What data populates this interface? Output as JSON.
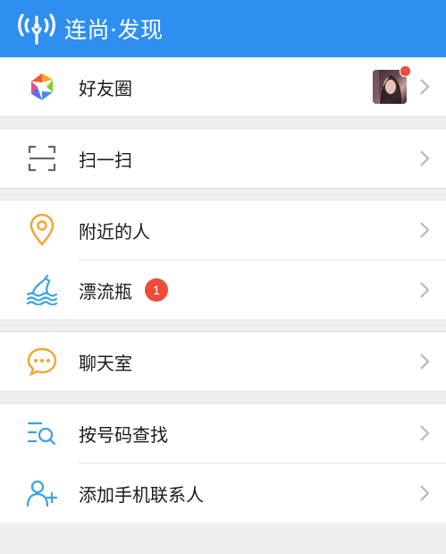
{
  "header": {
    "title": "连尚·发现"
  },
  "groups": [
    {
      "items": [
        {
          "label": "好友圈",
          "icon": "moments-icon"
        }
      ]
    },
    {
      "items": [
        {
          "label": "扫一扫",
          "icon": "scan-icon"
        }
      ]
    },
    {
      "items": [
        {
          "label": "附近的人",
          "icon": "location-pin-icon"
        },
        {
          "label": "漂流瓶",
          "icon": "drift-bottle-icon",
          "badge": "1"
        }
      ]
    },
    {
      "items": [
        {
          "label": "聊天室",
          "icon": "chat-room-icon"
        }
      ]
    },
    {
      "items": [
        {
          "label": "按号码查找",
          "icon": "search-list-icon"
        },
        {
          "label": "添加手机联系人",
          "icon": "add-contact-icon"
        }
      ]
    }
  ],
  "colors": {
    "header_bg": "#2f8ff0",
    "badge": "#ee4b3c",
    "accent_orange": "#f2a531",
    "accent_blue": "#38a3e0"
  }
}
